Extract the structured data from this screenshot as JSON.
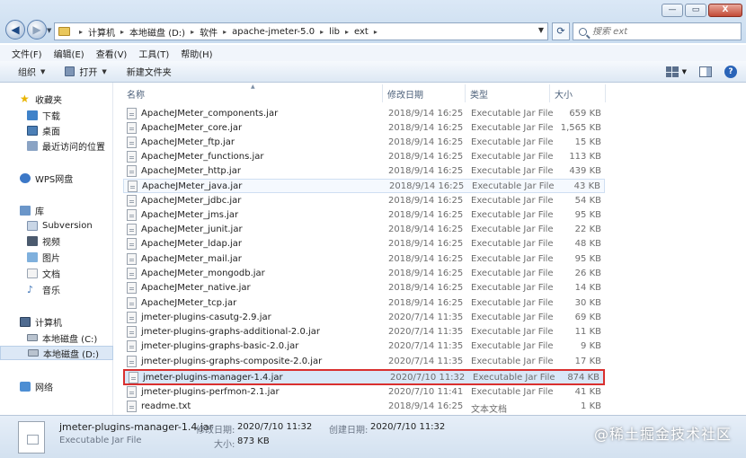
{
  "window": {
    "controls": {
      "minimize": "—",
      "maximize": "▭",
      "close": "X"
    }
  },
  "navigation": {
    "back": "◀",
    "forward": "▶",
    "refresh": "⟳"
  },
  "address": {
    "crumbs": [
      "计算机",
      "本地磁盘 (D:)",
      "软件",
      "apache-jmeter-5.0",
      "lib",
      "ext"
    ]
  },
  "search": {
    "placeholder": "搜索 ext"
  },
  "menubar": {
    "items": [
      "文件(F)",
      "编辑(E)",
      "查看(V)",
      "工具(T)",
      "帮助(H)"
    ]
  },
  "toolbar": {
    "organize": "组织",
    "open": "打开",
    "new_folder": "新建文件夹"
  },
  "sidebar": {
    "favorites": "收藏夹",
    "downloads": "下载",
    "desktop": "桌面",
    "recent": "最近访问的位置",
    "wps": "WPS网盘",
    "libraries": "库",
    "subversion": "Subversion",
    "videos": "视频",
    "pictures": "图片",
    "documents": "文档",
    "music": "音乐",
    "computer": "计算机",
    "drive_c": "本地磁盘 (C:)",
    "drive_d": "本地磁盘 (D:)",
    "network": "网络"
  },
  "columns": {
    "name": "名称",
    "modified": "修改日期",
    "type": "类型",
    "size": "大小"
  },
  "files": [
    {
      "name": "ApacheJMeter_components.jar",
      "modified": "2018/9/14 16:25",
      "type": "Executable Jar File",
      "size": "659 KB"
    },
    {
      "name": "ApacheJMeter_core.jar",
      "modified": "2018/9/14 16:25",
      "type": "Executable Jar File",
      "size": "1,565 KB"
    },
    {
      "name": "ApacheJMeter_ftp.jar",
      "modified": "2018/9/14 16:25",
      "type": "Executable Jar File",
      "size": "15 KB"
    },
    {
      "name": "ApacheJMeter_functions.jar",
      "modified": "2018/9/14 16:25",
      "type": "Executable Jar File",
      "size": "113 KB"
    },
    {
      "name": "ApacheJMeter_http.jar",
      "modified": "2018/9/14 16:25",
      "type": "Executable Jar File",
      "size": "439 KB"
    },
    {
      "name": "ApacheJMeter_java.jar",
      "modified": "2018/9/14 16:25",
      "type": "Executable Jar File",
      "size": "43 KB"
    },
    {
      "name": "ApacheJMeter_jdbc.jar",
      "modified": "2018/9/14 16:25",
      "type": "Executable Jar File",
      "size": "54 KB"
    },
    {
      "name": "ApacheJMeter_jms.jar",
      "modified": "2018/9/14 16:25",
      "type": "Executable Jar File",
      "size": "95 KB"
    },
    {
      "name": "ApacheJMeter_junit.jar",
      "modified": "2018/9/14 16:25",
      "type": "Executable Jar File",
      "size": "22 KB"
    },
    {
      "name": "ApacheJMeter_ldap.jar",
      "modified": "2018/9/14 16:25",
      "type": "Executable Jar File",
      "size": "48 KB"
    },
    {
      "name": "ApacheJMeter_mail.jar",
      "modified": "2018/9/14 16:25",
      "type": "Executable Jar File",
      "size": "95 KB"
    },
    {
      "name": "ApacheJMeter_mongodb.jar",
      "modified": "2018/9/14 16:25",
      "type": "Executable Jar File",
      "size": "26 KB"
    },
    {
      "name": "ApacheJMeter_native.jar",
      "modified": "2018/9/14 16:25",
      "type": "Executable Jar File",
      "size": "14 KB"
    },
    {
      "name": "ApacheJMeter_tcp.jar",
      "modified": "2018/9/14 16:25",
      "type": "Executable Jar File",
      "size": "30 KB"
    },
    {
      "name": "jmeter-plugins-casutg-2.9.jar",
      "modified": "2020/7/14 11:35",
      "type": "Executable Jar File",
      "size": "69 KB"
    },
    {
      "name": "jmeter-plugins-graphs-additional-2.0.jar",
      "modified": "2020/7/14 11:35",
      "type": "Executable Jar File",
      "size": "11 KB"
    },
    {
      "name": "jmeter-plugins-graphs-basic-2.0.jar",
      "modified": "2020/7/14 11:35",
      "type": "Executable Jar File",
      "size": "9 KB"
    },
    {
      "name": "jmeter-plugins-graphs-composite-2.0.jar",
      "modified": "2020/7/14 11:35",
      "type": "Executable Jar File",
      "size": "17 KB"
    },
    {
      "name": "jmeter-plugins-manager-1.4.jar",
      "modified": "2020/7/10 11:32",
      "type": "Executable Jar File",
      "size": "874 KB"
    },
    {
      "name": "jmeter-plugins-perfmon-2.1.jar",
      "modified": "2020/7/10 11:41",
      "type": "Executable Jar File",
      "size": "41 KB"
    },
    {
      "name": "readme.txt",
      "modified": "2018/9/14 16:25",
      "type": "文本文档",
      "size": "1 KB"
    }
  ],
  "details": {
    "filename": "jmeter-plugins-manager-1.4.jar",
    "filetype": "Executable Jar File",
    "modified_label": "修改日期:",
    "modified_value": "2020/7/10 11:32",
    "created_label": "创建日期:",
    "created_value": "2020/7/10 11:32",
    "size_label": "大小:",
    "size_value": "873 KB"
  },
  "watermark": "@稀土掘金技术社区"
}
